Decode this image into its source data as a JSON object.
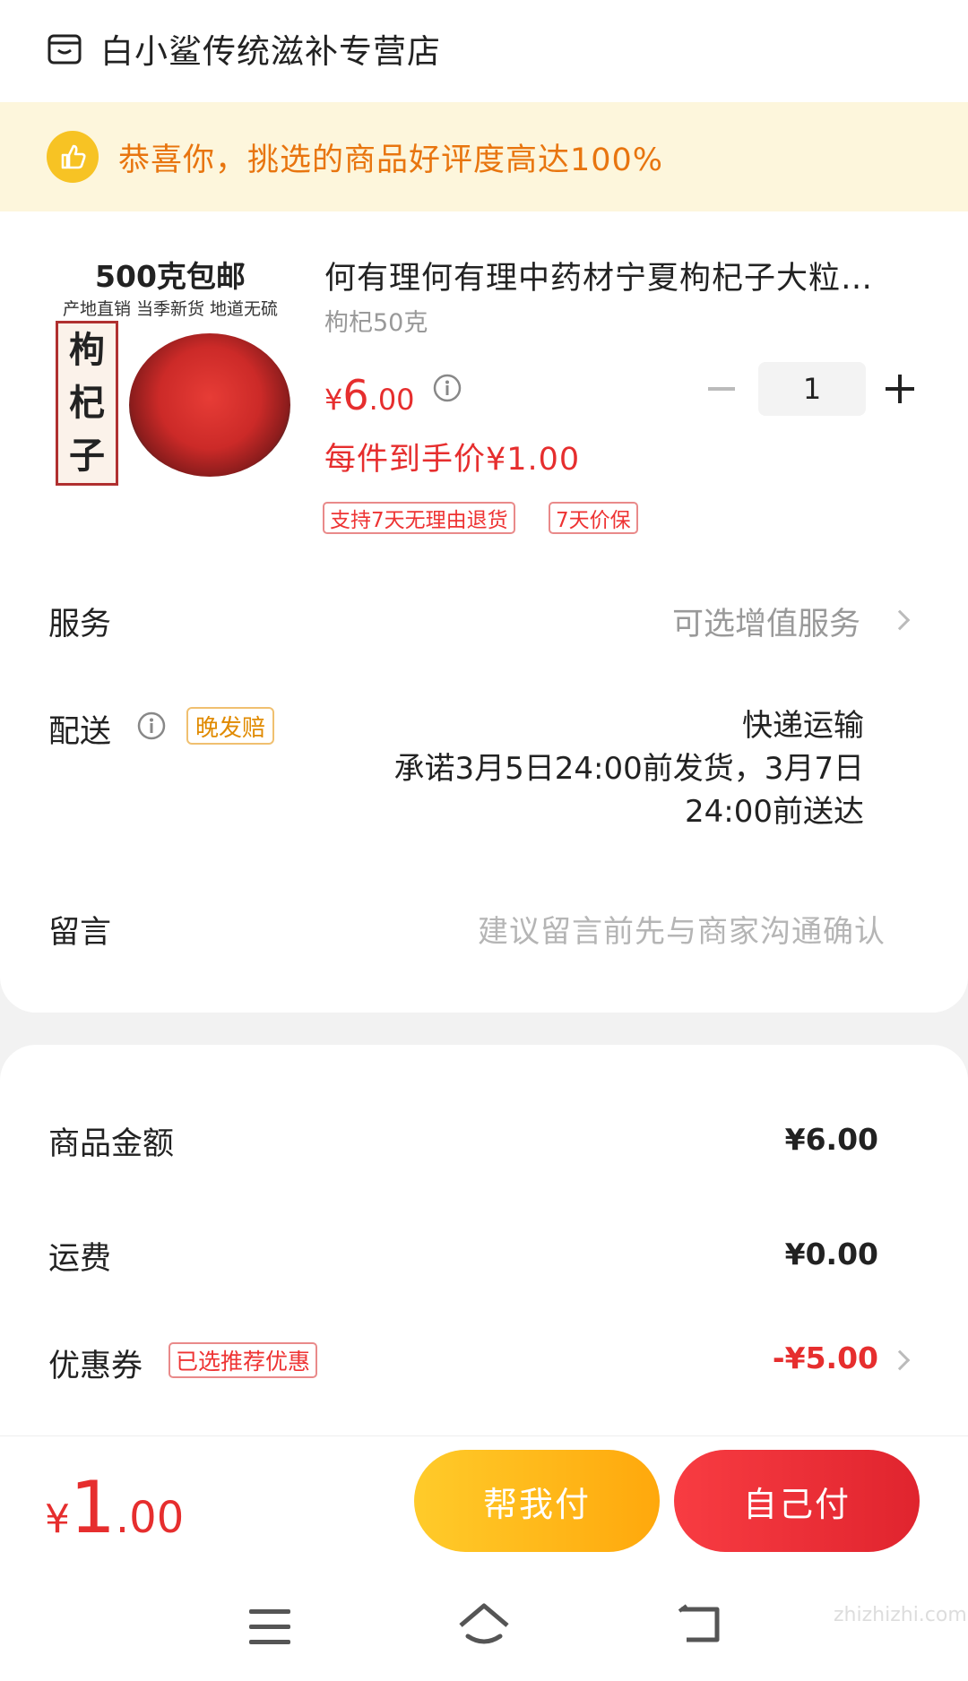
{
  "store": {
    "name": "白小鲨传统滋补专营店"
  },
  "banner": {
    "text": "恭喜你，挑选的商品好评度高达100%"
  },
  "product": {
    "image_title": "500克包邮",
    "image_subtitle": "产地直销 当季新货 地道无硫",
    "image_label": [
      "枸",
      "杞",
      "子"
    ],
    "title": "何有理何有理中药材宁夏枸杞子大粒…",
    "spec": "枸杞50克",
    "price_symbol": "¥",
    "price_int": "6",
    "price_dec": ".00",
    "quantity": "1",
    "unit_price": "每件到手价¥1.00",
    "tags": [
      "支持7天无理由退货",
      "7天价保"
    ]
  },
  "service": {
    "label": "服务",
    "value": "可选增值服务"
  },
  "delivery": {
    "label": "配送",
    "badge": "晚发赔",
    "method": "快递运输",
    "promise_line1": "承诺3月5日24:00前发货，3月7日",
    "promise_line2": "24:00前送达"
  },
  "message": {
    "label": "留言",
    "placeholder": "建议留言前先与商家沟通确认"
  },
  "summary": {
    "goods_label": "商品金额",
    "goods_value": "¥6.00",
    "shipping_label": "运费",
    "shipping_value": "¥0.00",
    "coupon_label": "优惠券",
    "coupon_tag": "已选推荐优惠",
    "coupon_value": "-¥5.00"
  },
  "footer": {
    "total_symbol": "¥",
    "total_int": "1",
    "total_dec": ".00",
    "help_pay": "帮我付",
    "self_pay": "自己付"
  },
  "watermark": "zhizhizhi.com",
  "colors": {
    "accent_red": "#e62e2e",
    "banner_bg": "#fdf6dc",
    "banner_text": "#e8750f",
    "help_pay_button": "#ffb81a",
    "self_pay_button": "#ef3038"
  }
}
